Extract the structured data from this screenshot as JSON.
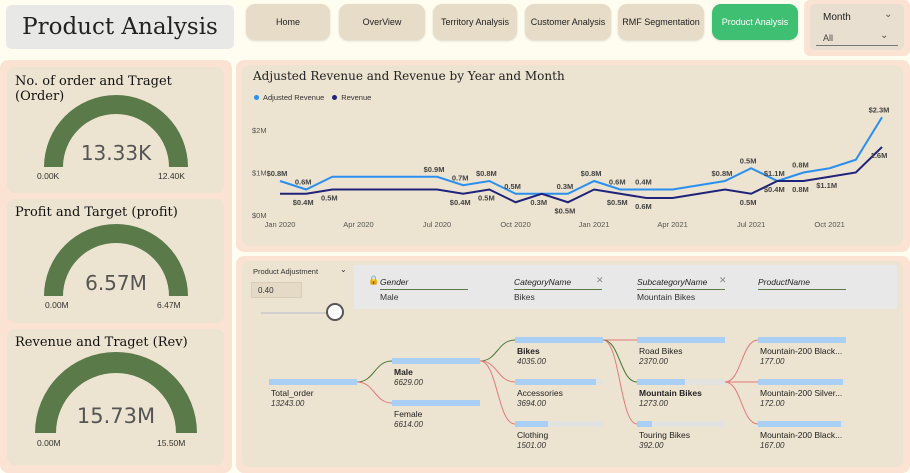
{
  "header": {
    "title": "Product Analysis"
  },
  "nav": {
    "items": [
      {
        "label": "Home"
      },
      {
        "label": "OverView"
      },
      {
        "label": "Territory Analysis"
      },
      {
        "label": "Customer Analysis"
      },
      {
        "label": "RMF Segmentation"
      },
      {
        "label": "Product Analysis",
        "active": true
      }
    ]
  },
  "month_slicer": {
    "label": "Month",
    "value": "All"
  },
  "gauges": [
    {
      "title": "No. of order and Traget (Order)",
      "value": "13.33K",
      "min": "0.00K",
      "max": "12.40K",
      "fill_fraction": 1.0,
      "color": "#5a7a4a"
    },
    {
      "title": "Profit and Target (profit)",
      "value": "6.57M",
      "min": "0.00M",
      "max": "6.47M",
      "fill_fraction": 1.0,
      "color": "#5a7a4a"
    },
    {
      "title": "Revenue and Traget (Rev)",
      "value": "15.73M",
      "min": "0.00M",
      "max": "15.50M",
      "fill_fraction": 1.0,
      "color": "#5a7a4a"
    }
  ],
  "chart_data": {
    "type": "line",
    "title": "Adjusted Revenue and Revenue by Year and Month",
    "legend_position": "top-left",
    "grid": false,
    "x": [
      "Jan 2020",
      "Feb 2020",
      "Mar 2020",
      "Apr 2020",
      "May 2020",
      "Jun 2020",
      "Jul 2020",
      "Aug 2020",
      "Sep 2020",
      "Oct 2020",
      "Nov 2020",
      "Dec 2020",
      "Jan 2021",
      "Feb 2021",
      "Mar 2021",
      "Apr 2021",
      "May 2021",
      "Jun 2021",
      "Jul 2021",
      "Aug 2021",
      "Sep 2021",
      "Oct 2021",
      "Nov 2021",
      "Dec 2021"
    ],
    "x_ticks": [
      "Jan 2020",
      "Apr 2020",
      "Jul 2020",
      "Oct 2020",
      "Jan 2021",
      "Apr 2021",
      "Jul 2021",
      "Oct 2021"
    ],
    "y_ticks": [
      "$0M",
      "$1M",
      "$2M"
    ],
    "ylim": [
      0,
      2.4
    ],
    "series": [
      {
        "name": "Adjusted Revenue",
        "color": "#2a8ff0",
        "values": [
          0.8,
          0.6,
          0.9,
          0.9,
          0.9,
          0.9,
          0.9,
          0.7,
          0.8,
          0.5,
          0.5,
          0.5,
          0.8,
          0.6,
          0.6,
          0.6,
          0.7,
          0.8,
          1.1,
          0.8,
          1.0,
          1.1,
          1.3,
          2.3
        ],
        "labels": {
          "0": "$0.8M",
          "1": "0.6M",
          "6": "$0.9M",
          "7": "0.7M",
          "8": "$0.8M",
          "9": "0.5M",
          "11": "0.3M",
          "12": "$0.8M",
          "13": "0.6M",
          "14": "0.4M",
          "17": "$0.8M",
          "18": "0.5M",
          "19": "$1.1M",
          "20": "0.8M",
          "23": "$2.3M"
        }
      },
      {
        "name": "Revenue",
        "color": "#1f237a",
        "values": [
          0.5,
          0.5,
          0.6,
          0.6,
          0.6,
          0.6,
          0.6,
          0.5,
          0.6,
          0.3,
          0.5,
          0.3,
          0.6,
          0.5,
          0.4,
          0.4,
          0.5,
          0.6,
          0.5,
          0.8,
          0.8,
          0.9,
          1.0,
          1.6
        ],
        "labels": {
          "1": "$0.4M",
          "2": "0.5M",
          "7": "$0.4M",
          "8": "0.5M",
          "10": "0.3M",
          "11": "$0.5M",
          "13": "$0.5M",
          "14": "0.6M",
          "18": "0.5M",
          "19": "$0.4M",
          "20": "0.8M",
          "21": "$1.1M",
          "23": "1.6M"
        }
      }
    ]
  },
  "decomposition": {
    "adjust": {
      "label": "Product Adjustment",
      "value": "0.40",
      "slider_fraction": 0.9
    },
    "levels": [
      {
        "header": "Gender",
        "selected": "Male",
        "lock": true
      },
      {
        "header": "CategoryName",
        "selected": "Bikes",
        "close": true
      },
      {
        "header": "SubcategoryName",
        "selected": "Mountain Bikes",
        "close": true
      },
      {
        "header": "ProductName",
        "selected": ""
      }
    ],
    "root": {
      "name": "Total_order",
      "value": "13243.00",
      "fraction": 1.0
    },
    "gender": [
      {
        "name": "Male",
        "value": "6629.00",
        "fraction": 1.0,
        "bold": true
      },
      {
        "name": "Female",
        "value": "6614.00",
        "fraction": 1.0
      }
    ],
    "category": [
      {
        "name": "Bikes",
        "value": "4035.00",
        "fraction": 1.0,
        "bold": true
      },
      {
        "name": "Accessories",
        "value": "3694.00",
        "fraction": 0.92
      },
      {
        "name": "Clothing",
        "value": "1501.00",
        "fraction": 0.37
      }
    ],
    "subcategory": [
      {
        "name": "Road Bikes",
        "value": "2370.00",
        "fraction": 1.0
      },
      {
        "name": "Mountain Bikes",
        "value": "1273.00",
        "fraction": 0.54,
        "bold": true
      },
      {
        "name": "Touring Bikes",
        "value": "392.00",
        "fraction": 0.17
      }
    ],
    "product": [
      {
        "name": "Mountain-200 Black...",
        "value": "177.00",
        "fraction": 1.0
      },
      {
        "name": "Mountain-200 Silver...",
        "value": "172.00",
        "fraction": 0.97
      },
      {
        "name": "Mountain-200 Black...",
        "value": "167.00",
        "fraction": 0.94
      }
    ]
  }
}
